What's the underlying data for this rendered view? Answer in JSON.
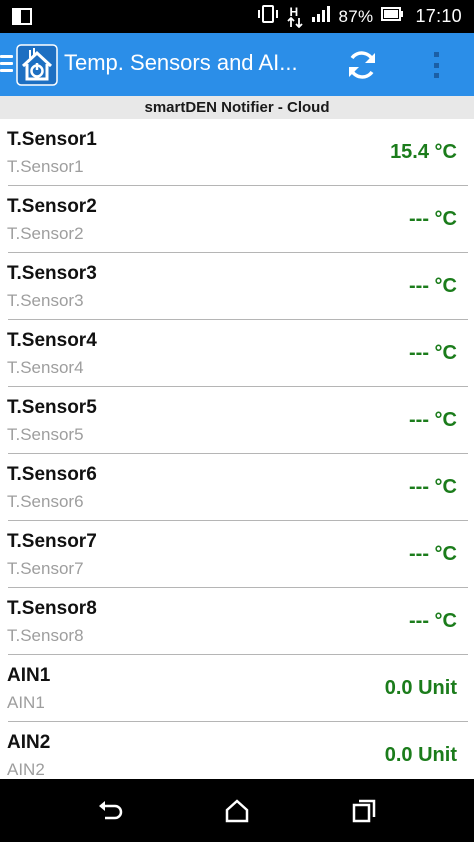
{
  "status_bar": {
    "battery_percent": "87%",
    "time": "17:10",
    "icons": [
      "screen-mirror-icon",
      "vibrate-icon",
      "data-transfer-icon",
      "signal-icon",
      "battery-icon"
    ],
    "network_letter": "H"
  },
  "app_bar": {
    "title": "Temp. Sensors and AI...",
    "icons": [
      "menu-icon",
      "app-logo-icon",
      "refresh-icon",
      "overflow-menu-icon"
    ],
    "color": "#2b8ee8"
  },
  "subheader": "smartDEN Notifier - Cloud",
  "items": [
    {
      "name": "T.Sensor1",
      "subtitle": "T.Sensor1",
      "value": "15.4 °C"
    },
    {
      "name": "T.Sensor2",
      "subtitle": "T.Sensor2",
      "value": "--- °C"
    },
    {
      "name": "T.Sensor3",
      "subtitle": "T.Sensor3",
      "value": "--- °C"
    },
    {
      "name": "T.Sensor4",
      "subtitle": "T.Sensor4",
      "value": "--- °C"
    },
    {
      "name": "T.Sensor5",
      "subtitle": "T.Sensor5",
      "value": "--- °C"
    },
    {
      "name": "T.Sensor6",
      "subtitle": "T.Sensor6",
      "value": "--- °C"
    },
    {
      "name": "T.Sensor7",
      "subtitle": "T.Sensor7",
      "value": "--- °C"
    },
    {
      "name": "T.Sensor8",
      "subtitle": "T.Sensor8",
      "value": "--- °C"
    },
    {
      "name": "AIN1",
      "subtitle": "AIN1",
      "value": "0.0 Unit"
    },
    {
      "name": "AIN2",
      "subtitle": "AIN2",
      "value": "0.0 Unit"
    }
  ],
  "value_color": "#1b7c1b",
  "nav_bar": {
    "icons": [
      "back-icon",
      "home-icon",
      "recent-apps-icon"
    ]
  }
}
